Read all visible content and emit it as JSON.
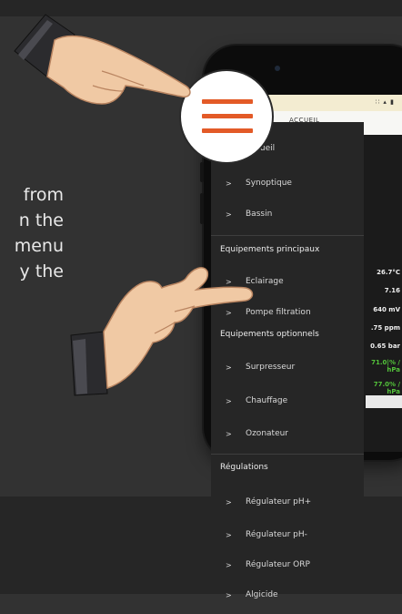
{
  "intro": {
    "lines": [
      "from",
      "n the",
      "menu",
      "y the"
    ]
  },
  "phone": {
    "status_icons": "∷ ▴ ▮",
    "appbar_title": "ACCUEIL",
    "values": [
      "26.7°C",
      "7.16",
      "640 mV",
      ".75 ppm",
      "0.65 bar"
    ],
    "green_values": [
      [
        "71.0|% /",
        "hPa"
      ],
      [
        "77.0% /",
        "hPa"
      ]
    ]
  },
  "drawer": {
    "items_top": [
      {
        "label": "Accueil"
      },
      {
        "label": "Synoptique"
      },
      {
        "label": "Bassin"
      }
    ],
    "section_main": "Equipements principaux",
    "items_main": [
      {
        "label": "Eclairage"
      },
      {
        "label": "Pompe filtration"
      }
    ],
    "section_optional": "Equipements optionnels",
    "items_optional": [
      {
        "label": "Surpresseur"
      },
      {
        "label": "Chauffage"
      },
      {
        "label": "Ozonateur"
      }
    ],
    "section_regulations": "Régulations",
    "items_regulations": [
      {
        "label": "Régulateur pH+"
      },
      {
        "label": "Régulateur pH-"
      },
      {
        "label": "Régulateur ORP"
      },
      {
        "label": "Algicide"
      }
    ],
    "chevron": ">"
  },
  "colors": {
    "accent": "#e35a27",
    "drawer_bg": "#262626",
    "page_bg": "#323232",
    "green_value": "#53c23a"
  }
}
